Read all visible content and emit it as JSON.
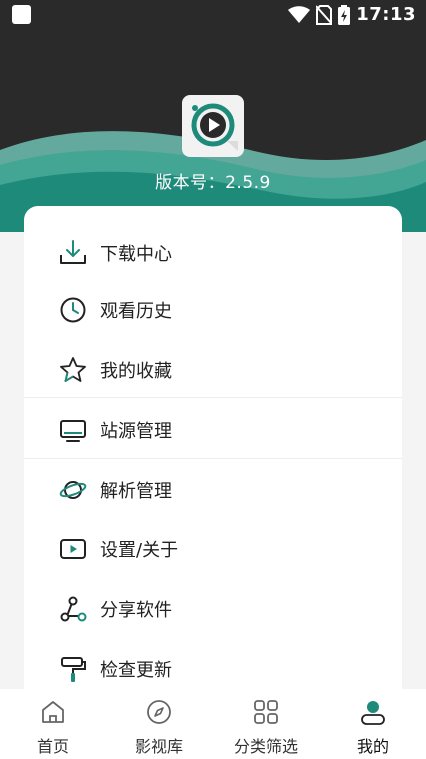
{
  "status_bar": {
    "time": "17:13",
    "icons": [
      "notification-square-icon",
      "wifi-icon",
      "no-sim-icon",
      "battery-charging-icon"
    ]
  },
  "header": {
    "version_text": "版本号：2.5.9",
    "colors": {
      "background": "#2a2a2a",
      "wave_light": "#7fc7bb",
      "wave_dark": "#1e8a7a"
    }
  },
  "menu": {
    "items": [
      {
        "label": "下载中心",
        "icon": "download-icon"
      },
      {
        "label": "观看历史",
        "icon": "clock-icon"
      },
      {
        "label": "我的收藏",
        "icon": "star-icon"
      },
      {
        "label": "站源管理",
        "icon": "monitor-icon"
      },
      {
        "label": "解析管理",
        "icon": "planet-icon"
      },
      {
        "label": "设置/关于",
        "icon": "play-box-icon"
      },
      {
        "label": "分享软件",
        "icon": "share-icon"
      },
      {
        "label": "检查更新",
        "icon": "paint-roller-icon"
      }
    ],
    "accent_color": "#1e8a7a"
  },
  "bottom_nav": {
    "items": [
      {
        "label": "首页",
        "icon": "home-icon"
      },
      {
        "label": "影视库",
        "icon": "compass-icon"
      },
      {
        "label": "分类筛选",
        "icon": "grid-icon"
      },
      {
        "label": "我的",
        "icon": "user-icon",
        "active": true
      }
    ]
  }
}
